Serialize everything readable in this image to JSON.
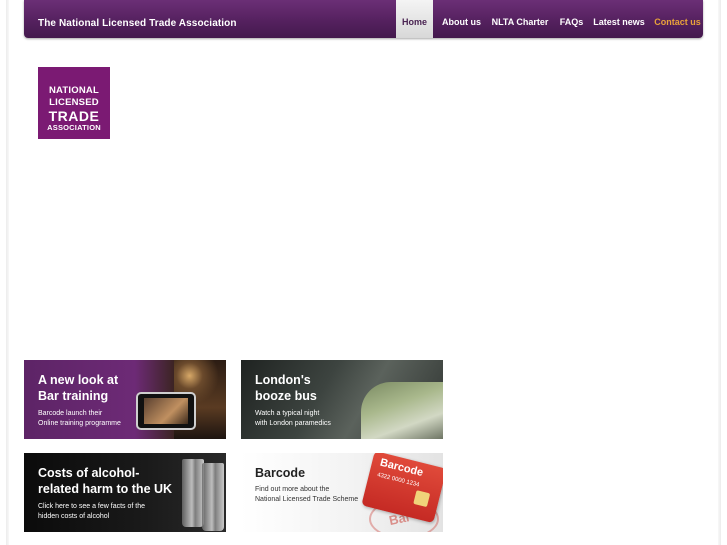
{
  "header": {
    "site_title": "The National Licensed Trade Association",
    "nav": [
      {
        "label": "Home",
        "active": true
      },
      {
        "label": "About us"
      },
      {
        "label": "NLTA Charter"
      },
      {
        "label": "FAQs"
      },
      {
        "label": "Latest news"
      },
      {
        "label": "Contact us",
        "color": "#e8a33a"
      }
    ]
  },
  "logo": {
    "lines": [
      "NATIONAL",
      "LICENSED",
      "TRADE",
      "ASSOCIATION"
    ],
    "color": "#7b1a73"
  },
  "banners": [
    {
      "title_line1": "A new look at",
      "title_line2": "Bar training",
      "sub_line1": "Barcode launch their",
      "sub_line2": "Online training programme"
    },
    {
      "title_line1": "London's",
      "title_line2": "booze bus",
      "sub_line1": "Watch a typical night",
      "sub_line2": "with London paramedics"
    },
    {
      "title_line1": "Costs of alcohol-",
      "title_line2": "related harm to the UK",
      "sub_line1": "Click here to see a few facts of the",
      "sub_line2": "hidden costs of alcohol"
    },
    {
      "title_line1": "Barcode",
      "title_line2": "",
      "sub_line1": "Find out more about the",
      "sub_line2": "National Licensed Trade Scheme",
      "card_label": "Barcode",
      "card_number": "4322 0000 1234",
      "stamp_text": "Bar"
    }
  ],
  "colors": {
    "header_purple": "#55215f",
    "accent_orange": "#e8a33a",
    "logo_purple": "#7b1a73"
  }
}
